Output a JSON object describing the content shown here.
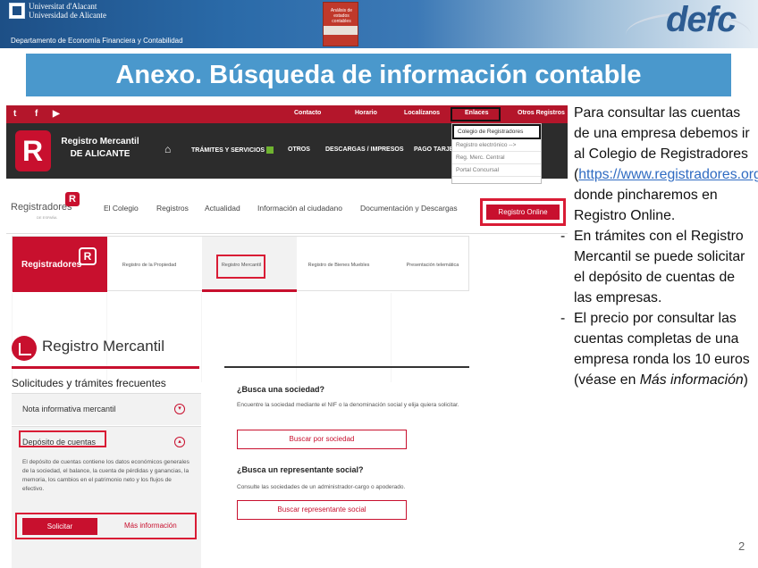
{
  "header": {
    "university_line1": "Universitat d'Alacant",
    "university_line2": "Universidad de Alicante",
    "department": "Departamento de Economía Financiera y Contabilidad",
    "book_title": "Análisis de estados contables",
    "logo_text": "defc"
  },
  "title": "Anexo. Búsqueda de información contable",
  "shot1": {
    "top_links": [
      "Contacto",
      "Horario",
      "Localízanos",
      "Enlaces",
      "Otros Registros"
    ],
    "brand_line1": "Registro Mercantil",
    "brand_line2": "DE ALICANTE",
    "nav": [
      "TRÁMITES Y SERVICIOS",
      "OTROS",
      "DESCARGAS / IMPRESOS",
      "PAGO TARJETA"
    ],
    "dropdown": [
      "Colegio de Registradores",
      "Registro electrónico -->",
      "Reg. Merc. Central",
      "Portal Concursal"
    ]
  },
  "shot2": {
    "logo": "Registradores",
    "logo_sub": "DE ESPAÑA",
    "nav": [
      "El Colegio",
      "Registros",
      "Actualidad",
      "Información al ciudadano",
      "Documentación y Descargas"
    ],
    "button": "Registro Online"
  },
  "shot3": {
    "logo": "Registradores",
    "tabs": [
      "Registro de la Propiedad",
      "Registro Mercantil",
      "Registro de Bienes Muebles",
      "Presentación telemática"
    ]
  },
  "shot4": {
    "heading": "Registro Mercantil",
    "solicitudes": "Solicitudes y trámites frecuentes",
    "item1": "Nota informativa mercantil",
    "item2": "Depósito de cuentas",
    "description": "El depósito de cuentas contiene los datos económicos generales de la sociedad, el balance, la cuenta de pérdidas y ganancias, la memoria, los cambios en el patrimonio neto y los flujos de efectivo.",
    "solicitar": "Solicitar",
    "mas_info": "Más información",
    "q1": "¿Busca una sociedad?",
    "q1_text": "Encuentre la sociedad mediante el NIF o la denominación social y elija quiera solicitar.",
    "q1_btn": "Buscar por sociedad",
    "q2": "¿Busca un representante social?",
    "q2_text": "Consulte las sociedades de un administrador-cargo o apoderado.",
    "q2_btn": "Buscar representante social"
  },
  "body": {
    "p1_before": "Para consultar las cuentas de una empresa debemos ir al Colegio de Registradores (",
    "p1_link": "https://www.registradores.org/",
    "p1_after": "), donde pincharemos en Registro Online.",
    "b1": "En trámites con el Registro Mercantil se puede solicitar el depósito de cuentas de las empresas.",
    "b2_before": "El precio por consultar las cuentas completas de una empresa ronda los 10 euros (véase en ",
    "b2_italic": "Más información",
    "b2_after": ")"
  },
  "page_number": "2"
}
